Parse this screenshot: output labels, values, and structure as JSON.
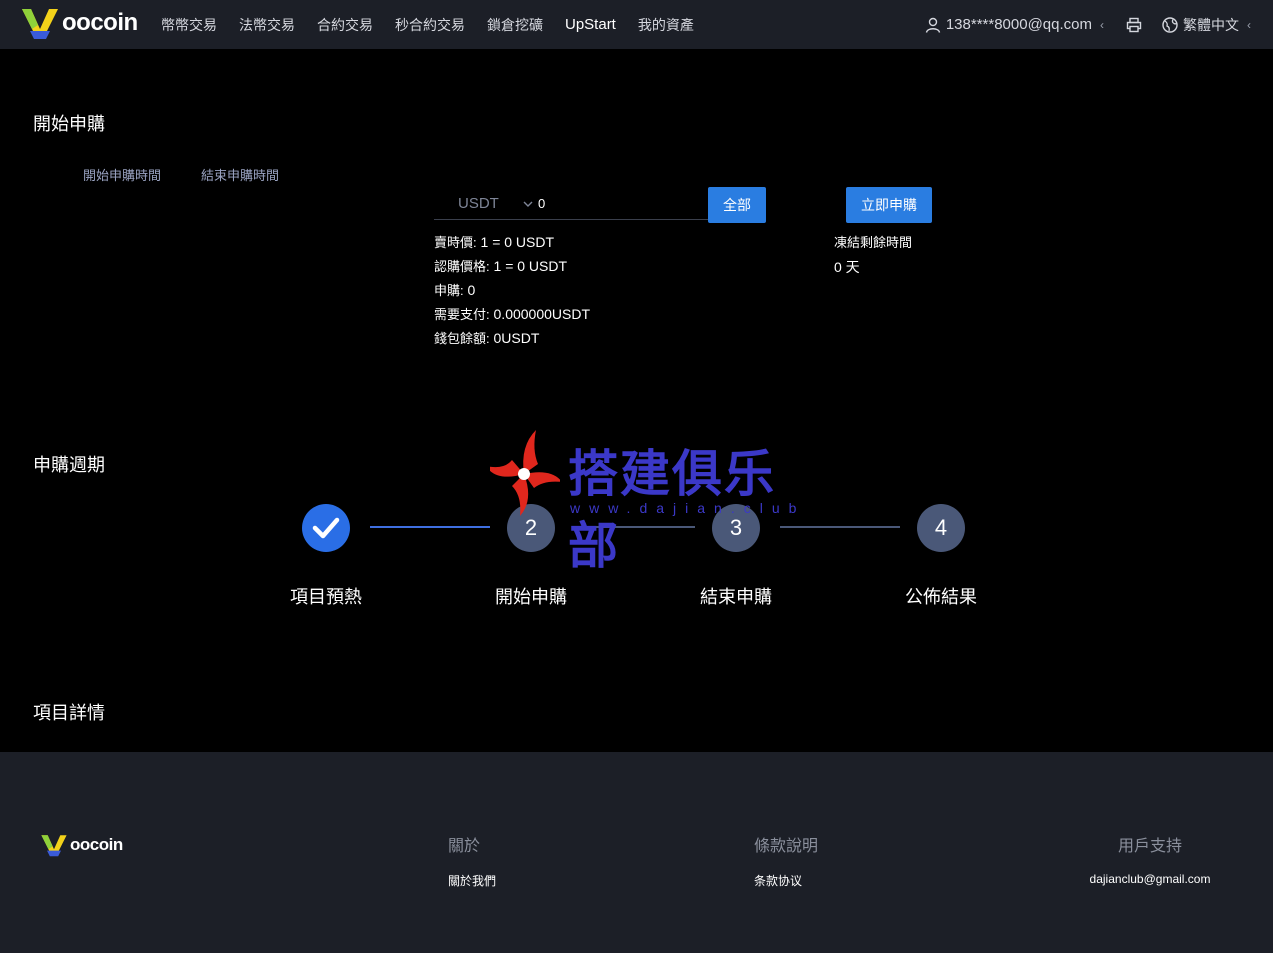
{
  "header": {
    "brand": "oocoin",
    "nav": [
      "幣幣交易",
      "法幣交易",
      "合約交易",
      "秒合約交易",
      "鎖倉挖礦",
      "UpStart",
      "我的資產"
    ],
    "user": "138****8000@qq.com",
    "language": "繁體中文"
  },
  "subscribe": {
    "title": "開始申購",
    "start_time_label": "開始申購時間",
    "end_time_label": "結束申購時間",
    "currency": "USDT",
    "amount": "0",
    "all_button": "全部",
    "submit_button": "立即申購",
    "rows": [
      {
        "key": "賣時價:",
        "value": "1 = 0 USDT"
      },
      {
        "key": "認購價格:",
        "value": "1 = 0 USDT"
      },
      {
        "key": "申購:",
        "value": "0"
      },
      {
        "key": "需要支付:",
        "value": "0.000000USDT"
      },
      {
        "key": "錢包餘額:",
        "value": "0USDT"
      }
    ],
    "freeze_label": "凍結剩餘時間",
    "freeze_value": "0 天"
  },
  "cycle": {
    "title": "申購週期",
    "steps": [
      {
        "num": "",
        "label": "項目預熱",
        "done": true
      },
      {
        "num": "2",
        "label": "開始申購",
        "done": false
      },
      {
        "num": "3",
        "label": "結束申購",
        "done": false
      },
      {
        "num": "4",
        "label": "公佈結果",
        "done": false
      }
    ]
  },
  "details": {
    "title": "項目詳情"
  },
  "watermark": {
    "title": "搭建俱乐部",
    "url": "www.dajian.club"
  },
  "footer": {
    "brand": "oocoin",
    "about": {
      "title": "關於",
      "link": "關於我們"
    },
    "terms": {
      "title": "條款說明",
      "link": "条款协议"
    },
    "support": {
      "title": "用戶支持",
      "link": "dajianclub@gmail.com"
    }
  },
  "colors": {
    "header_bg": "#1c1f27",
    "accent": "#2a7de1",
    "step_done": "#2a6ee6",
    "step_todo": "#4a5878"
  }
}
